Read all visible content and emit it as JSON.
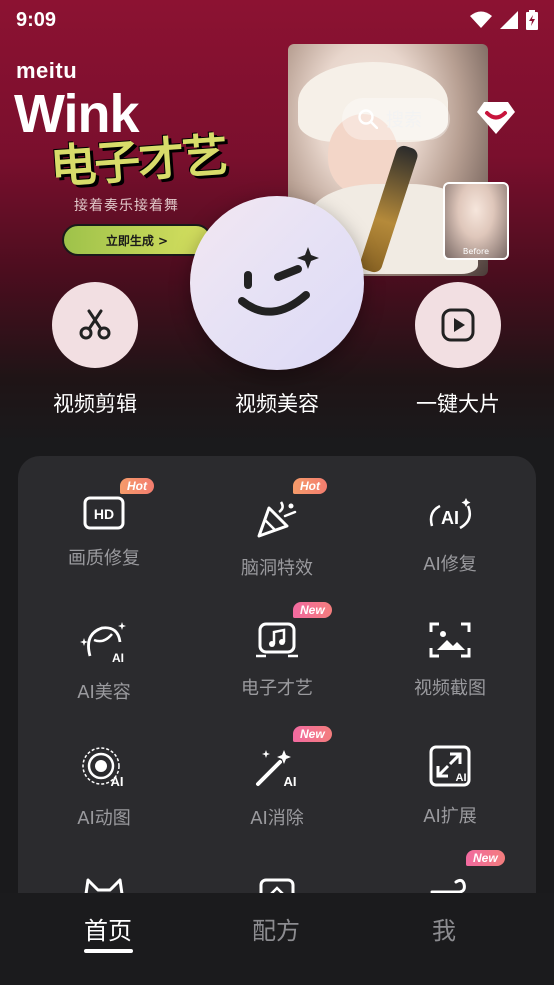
{
  "status": {
    "time": "9:09"
  },
  "hero": {
    "brand_small": "meitu",
    "brand_large": "Wink",
    "banner_title": "电子才艺",
    "banner_subtitle": "接着奏乐接着舞",
    "banner_cta": "立即生成 >",
    "search_placeholder": "搜索",
    "thumb_label": "Before"
  },
  "main_actions": [
    {
      "label": "视频剪辑",
      "icon": "scissors-icon"
    },
    {
      "label": "视频美容",
      "icon": "wink-face-icon"
    },
    {
      "label": "一键大片",
      "icon": "play-icon"
    }
  ],
  "tools": [
    {
      "label": "画质修复",
      "icon": "hd-icon",
      "badge": "Hot"
    },
    {
      "label": "脑洞特效",
      "icon": "party-popper-icon",
      "badge": "Hot"
    },
    {
      "label": "AI修复",
      "icon": "ai-sparkle-icon",
      "badge": ""
    },
    {
      "label": "AI美容",
      "icon": "ai-face-icon",
      "badge": ""
    },
    {
      "label": "电子才艺",
      "icon": "music-note-icon",
      "badge": "New"
    },
    {
      "label": "视频截图",
      "icon": "screenshot-icon",
      "badge": ""
    },
    {
      "label": "AI动图",
      "icon": "ai-motion-icon",
      "badge": ""
    },
    {
      "label": "AI消除",
      "icon": "magic-wand-icon",
      "badge": "New"
    },
    {
      "label": "AI扩展",
      "icon": "expand-icon",
      "badge": ""
    },
    {
      "label": "",
      "icon": "cat-icon",
      "badge": ""
    },
    {
      "label": "",
      "icon": "image-sparkle-icon",
      "badge": ""
    },
    {
      "label": "",
      "icon": "wind-icon",
      "badge": "New"
    }
  ],
  "tabs": [
    {
      "label": "首页",
      "active": true
    },
    {
      "label": "配方",
      "active": false
    },
    {
      "label": "我",
      "active": false
    }
  ],
  "colors": {
    "hero_top": "#8c1232",
    "card_bg": "#2b2b2e",
    "tabbar_bg": "#1b1b1d",
    "hot_badge": "#f59b6a",
    "new_badge": "#f26aa0"
  }
}
